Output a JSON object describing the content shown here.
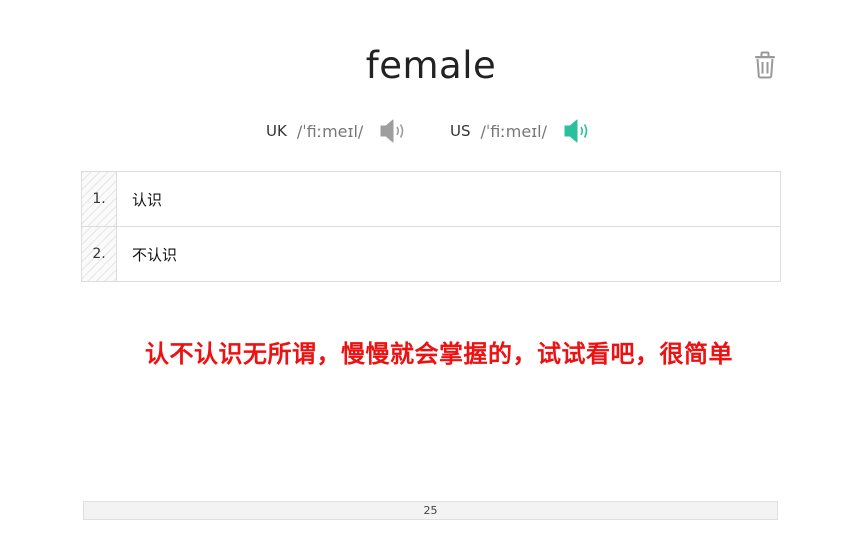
{
  "word": "female",
  "pronunciation": {
    "uk": {
      "region": "UK",
      "ipa": "/ˈfiːmeɪl/",
      "speaker_icon": "speaker-icon",
      "speaker_color": "#9e9e9e"
    },
    "us": {
      "region": "US",
      "ipa": "/ˈfiːmeɪl/",
      "speaker_icon": "speaker-icon",
      "speaker_color": "#2bbf9b"
    }
  },
  "options": [
    {
      "number": "1.",
      "label": "认识"
    },
    {
      "number": "2.",
      "label": "不认识"
    }
  ],
  "hint": "认不认识无所谓，慢慢就会掌握的，试试看吧，很简单",
  "hint_color": "#ee1111",
  "progress": {
    "label": "25"
  },
  "delete_icon": "trash-icon"
}
